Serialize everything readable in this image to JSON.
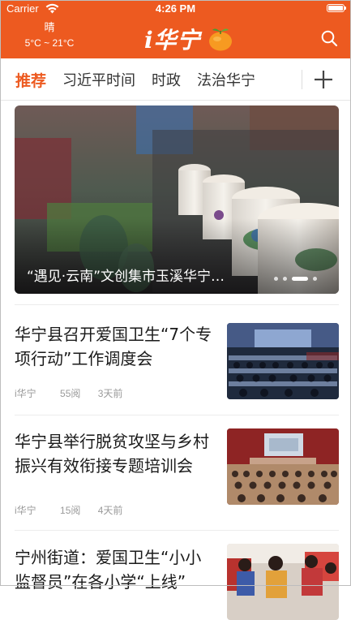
{
  "status_bar": {
    "carrier": "Carrier",
    "time": "4:26 PM"
  },
  "header": {
    "weather_condition": "晴",
    "weather_temp": "5°C ~ 21°C",
    "logo_text": "i华宁",
    "brand_color": "#ed5a20"
  },
  "channels": {
    "tabs": [
      {
        "label": "推荐",
        "active": true
      },
      {
        "label": "习近平时间",
        "active": false
      },
      {
        "label": "时政",
        "active": false
      },
      {
        "label": "法治华宁",
        "active": false
      }
    ],
    "add_icon": "plus-icon"
  },
  "banner": {
    "caption": "“遇见·云南”文创集市玉溪华宁…",
    "dots": 4,
    "active_dot": 2
  },
  "news": [
    {
      "title": "华宁县召开爱国卫生“7个专项行动”工作调度会",
      "source": "i华宁",
      "reads": "55阅",
      "time": "3天前",
      "thumb": "meeting-hall-photo"
    },
    {
      "title": "华宁县举行脱贫攻坚与乡村振兴有效衔接专题培训会",
      "source": "i华宁",
      "reads": "15阅",
      "time": "4天前",
      "thumb": "training-session-photo"
    },
    {
      "title": "宁州街道：爱国卫生“小小监督员”在各小学“上线”",
      "source": "",
      "reads": "",
      "time": "",
      "thumb": "schoolchildren-photo"
    }
  ]
}
